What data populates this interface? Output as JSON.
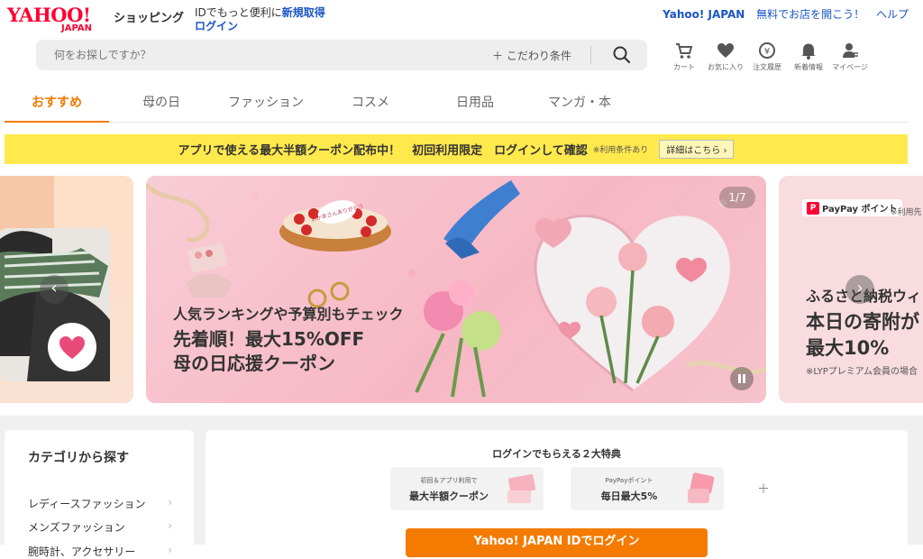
{
  "header": {
    "logo_main": "YAHOO!",
    "logo_sub": "JAPAN",
    "shop_title": "ショッピング",
    "id_promo_text": "IDでもっと便利に",
    "id_promo_link": "新規取得",
    "login_link": "ログイン",
    "top_links": [
      "Yahoo! JAPAN",
      "無料でお店を開こう！",
      "ヘルプ"
    ]
  },
  "search": {
    "placeholder": "何をお探しですか？",
    "conditions_label": "＋ こだわり条件",
    "icon": "search-icon"
  },
  "nav_icons": [
    {
      "icon": "cart-icon",
      "label": "カート"
    },
    {
      "icon": "heart-icon",
      "label": "お気に入り"
    },
    {
      "icon": "history-icon",
      "label": "注文履歴"
    },
    {
      "icon": "bell-icon",
      "label": "新着情報"
    },
    {
      "icon": "user-icon",
      "label": "マイページ"
    }
  ],
  "tabs": [
    "おすすめ",
    "母の日",
    "ファッション",
    "コスメ",
    "日用品",
    "マンガ・本"
  ],
  "coupon_banner": {
    "message": "アプリで使える最大半額クーポン配布中！　初回利用限定　ログインして確認",
    "note": "※利用条件あり",
    "detail_label": "詳細はこちら"
  },
  "carousel": {
    "counter": "1/7",
    "main_line1": "人気ランキングや予算別もチェック",
    "main_line2": "先着順！最大15%OFF",
    "main_line3": "母の日応援クーポン",
    "cake_text": "おかあさんありがとう",
    "right_badge": "PayPay ポイント",
    "right_note": "※利用先",
    "right_line1": "ふるさと納税ウィ",
    "right_line2": "本日の寄附が",
    "right_line3": "最大10%",
    "right_line4": "※LYPプレミアム会員の場合"
  },
  "categories": {
    "title": "カテゴリから探す",
    "items": [
      "レディースファッション",
      "メンズファッション",
      "腕時計、アクセサリー"
    ]
  },
  "login_panel": {
    "title": "ログインでもらえる２大特典",
    "benefit1_small": "初回＆アプリ利用で",
    "benefit1_big": "最大半額クーポン",
    "benefit2_small": "PayPayポイント",
    "benefit2_big": "毎日最大5%",
    "plus": "＋",
    "button": "Yahoo! JAPAN IDでログイン"
  },
  "colors": {
    "accent_orange": "#f47b00",
    "brand_red": "#ff0033",
    "link_blue": "#1a55c4",
    "banner_yellow": "#ffe94c"
  }
}
